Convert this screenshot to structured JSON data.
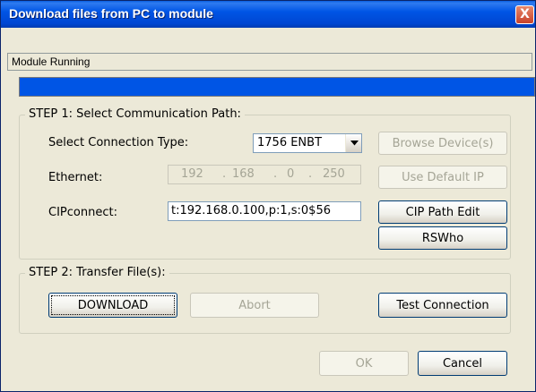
{
  "window": {
    "title": "Download files from PC to module",
    "close_glyph": "X"
  },
  "status": {
    "text": "Module Running",
    "progress": 1.0,
    "progress_color": "#0055E5"
  },
  "step1": {
    "label": "STEP 1: Select Communication Path:",
    "connection_type_label": "Select Connection Type:",
    "connection_type_value": "1756 ENBT",
    "ethernet_label": "Ethernet:",
    "ip": [
      "192",
      "168",
      "0",
      "250"
    ],
    "ip_dot": ".",
    "cipconnect_label": "CIPconnect:",
    "cipconnect_value": "t:192.168.0.100,p:1,s:0$56",
    "browse_button": "Browse Device(s)",
    "default_ip_button": "Use Default IP",
    "cip_path_edit_button": "CIP Path Edit",
    "rswho_button": "RSWho"
  },
  "step2": {
    "label": "STEP 2: Transfer File(s):",
    "download_button": "DOWNLOAD",
    "abort_button": "Abort",
    "test_connection_button": "Test Connection"
  },
  "footer": {
    "ok_button": "OK",
    "cancel_button": "Cancel"
  },
  "colors": {
    "title_bar": "#0055E5",
    "dialog_bg": "#ECE9D8",
    "close_button": "#C8422A"
  },
  "icons": {
    "close": "close-icon",
    "dropdown": "chevron-down-icon"
  }
}
